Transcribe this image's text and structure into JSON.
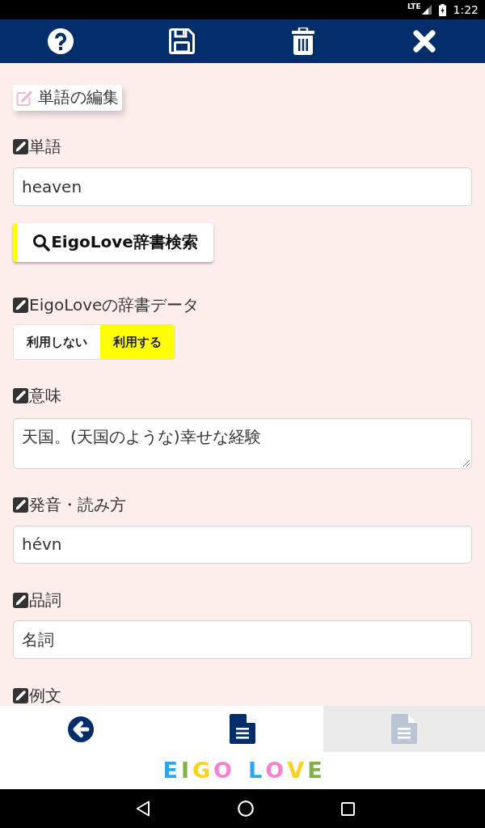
{
  "status_bar": {
    "network": "LTE",
    "time": "1:22"
  },
  "toolbar": {
    "buttons": [
      {
        "kind": "help"
      },
      {
        "kind": "save"
      },
      {
        "kind": "delete"
      },
      {
        "kind": "close"
      }
    ]
  },
  "form": {
    "title": "単語の編集",
    "items": [
      {
        "kind": "input",
        "label": "単語",
        "value": "heaven"
      },
      {
        "kind": "search_button",
        "label": "EigoLove辞書検索"
      },
      {
        "kind": "toggle",
        "label": "EigoLoveの辞書データ",
        "options": [
          {
            "label": "利用しない",
            "selected": false
          },
          {
            "label": "利用する",
            "selected": true
          }
        ]
      },
      {
        "kind": "textarea",
        "label": "意味",
        "value": "天国。(天国のような)幸せな経験"
      },
      {
        "kind": "input",
        "label": "発音・読み方",
        "value": "hévn"
      },
      {
        "kind": "input",
        "label": "品詞",
        "value": "名詞"
      },
      {
        "kind": "label",
        "label": "例文"
      }
    ]
  },
  "bottom_nav": {
    "items": [
      {
        "kind": "back",
        "disabled": false
      },
      {
        "kind": "page",
        "disabled": false
      },
      {
        "kind": "page",
        "disabled": true
      }
    ]
  },
  "logo": {
    "words": [
      {
        "letters": [
          {
            "char": "E",
            "color": "#2ba6f2"
          },
          {
            "char": "I",
            "color": "#7cb342"
          },
          {
            "char": "G",
            "color": "#fcd116"
          },
          {
            "char": "O",
            "color": "#f77fcf"
          }
        ]
      },
      {
        "letters": [
          {
            "char": "L",
            "color": "#2ba6f2"
          },
          {
            "char": "O",
            "color": "#f77fcf"
          },
          {
            "char": "V",
            "color": "#fcd116"
          },
          {
            "char": "E",
            "color": "#7cb342"
          }
        ]
      }
    ]
  }
}
